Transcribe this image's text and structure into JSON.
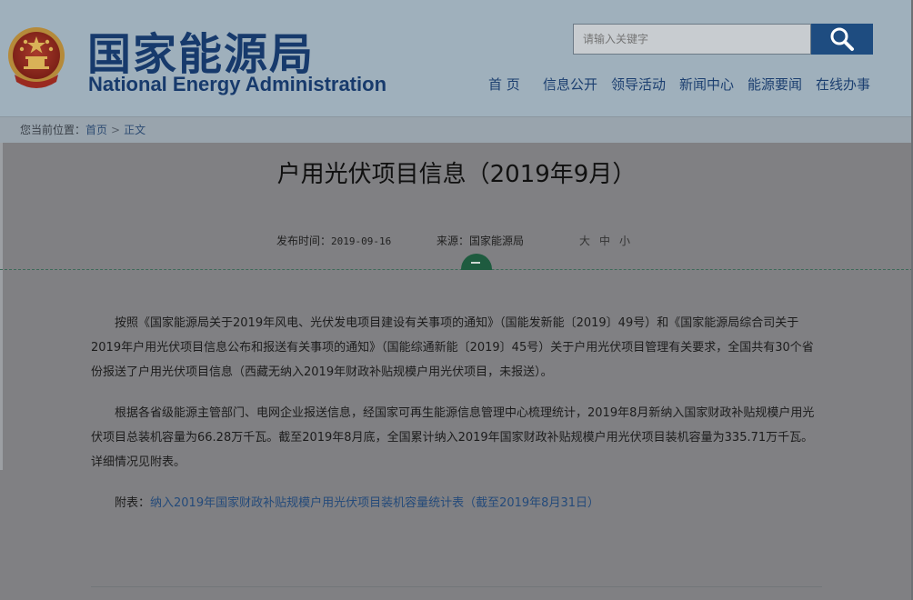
{
  "header": {
    "logo_cn": "国家能源局",
    "logo_en": "National Energy Administration",
    "search": {
      "placeholder": "请输入关键字"
    },
    "nav": [
      "首 页",
      "信息公开",
      "领导活动",
      "新闻中心",
      "能源要闻",
      "在线办事"
    ]
  },
  "breadcrumb": {
    "prefix": "您当前位置：",
    "items": [
      "首页",
      "正文"
    ],
    "separator": ">"
  },
  "article": {
    "title": "户用光伏项目信息（2019年9月）",
    "date_label": "发布时间：",
    "date_value": "2019-09-16",
    "source_label": "来源：",
    "source_value": "国家能源局",
    "font_size_options": [
      "大",
      "中",
      "小"
    ],
    "paragraphs": [
      "按照《国家能源局关于2019年风电、光伏发电项目建设有关事项的通知》（国能发新能〔2019〕49号）和《国家能源局综合司关于2019年户用光伏项目信息公布和报送有关事项的通知》（国能综通新能〔2019〕45号）关于户用光伏项目管理有关要求，全国共有30个省份报送了户用光伏项目信息（西藏无纳入2019年财政补贴规模户用光伏项目，未报送）。",
      "根据各省级能源主管部门、电网企业报送信息，经国家可再生能源信息管理中心梳理统计，2019年8月新纳入国家财政补贴规模户用光伏项目总装机容量为66.28万千瓦。截至2019年8月底，全国累计纳入2019年国家财政补贴规模户用光伏项目装机容量为335.71万千瓦。详细情况见附表。"
    ],
    "attachment_label": "附表：",
    "attachment_link": "纳入2019年国家财政补贴规模户用光伏项目装机容量统计表（截至2019年8月31日）"
  },
  "colors": {
    "header_bg": "#9fb0bc",
    "brand_blue": "#173a6c",
    "search_button": "#1e4c80",
    "divider_knob": "#1e5b3f"
  }
}
